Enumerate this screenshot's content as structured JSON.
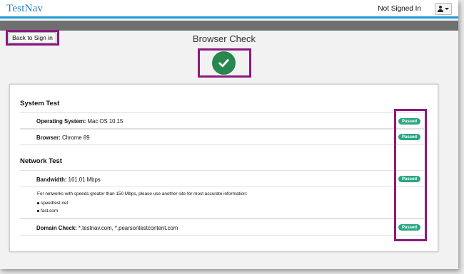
{
  "header": {
    "brand": "TestNav",
    "sign_in_status": "Not Signed In"
  },
  "toolbar": {
    "back_label": "Back to Sign in"
  },
  "main": {
    "title": "Browser Check"
  },
  "system_test": {
    "title": "System Test",
    "rows": [
      {
        "label": "Operating System:",
        "value": " Mac OS 10.15",
        "status": "Passed"
      },
      {
        "label": "Browser:",
        "value": " Chrome 89",
        "status": "Passed"
      }
    ]
  },
  "network_test": {
    "title": "Network Test",
    "bandwidth": {
      "label": "Bandwidth:",
      "value": " 161.01 Mbps",
      "status": "Passed"
    },
    "info": "For networks with speeds greater than 150 Mbps, please use another site for most accurate information:",
    "links": [
      "speedtest.net",
      "fast.com"
    ],
    "domain": {
      "label": "Domain Check:",
      "value": " *.testnav.com, *.pearsontestcontent.com",
      "status": "Passed"
    }
  },
  "colors": {
    "accent_blue": "#1e9ad6",
    "success_green": "#27874f",
    "badge_teal": "#27a784",
    "highlight_purple": "#8b1a7e"
  },
  "icons": {
    "user": "user-icon",
    "caret": "caret-down-icon",
    "check": "check-circle-icon"
  }
}
